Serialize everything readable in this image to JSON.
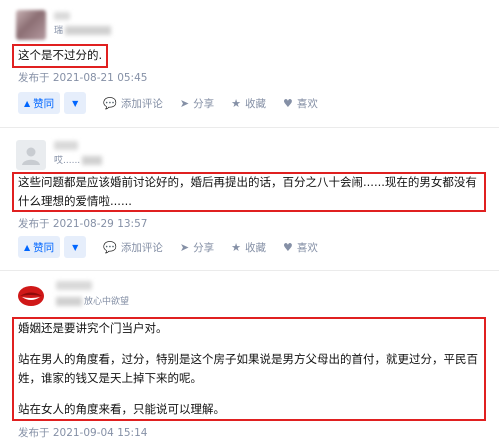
{
  "answers": [
    {
      "author_sub": "瑞",
      "content": [
        "这个是不过分的."
      ],
      "date": "发布于 2021-08-21 05:45"
    },
    {
      "author_sub": "哎......",
      "content": [
        "这些问题都是应该婚前讨论好的，婚后再提出的话，百分之八十会闹......现在的男女都没有什么理想的爱情啦......"
      ],
      "date": "发布于 2021-08-29 13:57"
    },
    {
      "author_sub": "放心中欲望",
      "content": [
        "婚姻还是要讲究个门当户对。",
        "站在男人的角度看，过分，特别是这个房子如果说是男方父母出的首付，就更过分，平民百姓，谁家的钱又是天上掉下来的呢。",
        "站在女人的角度来看，只能说可以理解。"
      ],
      "date": "发布于 2021-09-04 15:14"
    }
  ],
  "actions": {
    "vote_up": "赞同",
    "comment": "添加评论",
    "share": "分享",
    "favorite": "收藏",
    "like": "喜欢"
  },
  "icons": {
    "vote_up": "triangle-up-icon",
    "vote_down": "triangle-down-icon",
    "comment": "comment-bubble-icon",
    "share": "share-plane-icon",
    "favorite": "star-icon",
    "like": "heart-icon"
  },
  "colors": {
    "accent": "#0066ff",
    "vote_bg": "#e6eefb",
    "meta": "#8590a6",
    "highlight_box": "#e02020"
  }
}
